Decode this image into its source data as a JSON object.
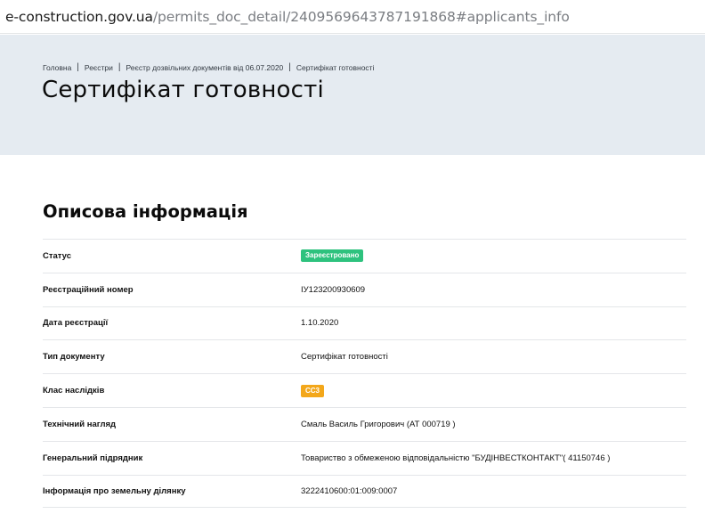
{
  "browser": {
    "url_host": "e-construction.gov.ua",
    "url_path": "/permits_doc_detail/2409569643787191868#applicants_info"
  },
  "breadcrumb": {
    "items": [
      "Головна",
      "Реєстри",
      "Реєстр дозвільних документів від 06.07.2020",
      "Сертифікат готовності"
    ],
    "separator": "|"
  },
  "page": {
    "title": "Сертифікат готовності"
  },
  "section": {
    "title": "Описова інформація"
  },
  "colors": {
    "status_badge": "#2ec27e",
    "class_badge": "#f3a71a",
    "hero_background": "#e5ebf1"
  },
  "rows": [
    {
      "label": "Статус",
      "value": "Зареєстровано"
    },
    {
      "label": "Реєстраційний номер",
      "value": "ІУ123200930609"
    },
    {
      "label": "Дата реєстрації",
      "value": "1.10.2020"
    },
    {
      "label": "Тип документу",
      "value": "Сертифікат готовності"
    },
    {
      "label": "Клас наслідків",
      "value": "СС3"
    },
    {
      "label": "Технічний нагляд",
      "value": "Смаль Василь Григорович (АТ 000719 )"
    },
    {
      "label": "Генеральний підрядник",
      "value": "Товариство з обмеженою відповідальністю \"БУДІНВЕСТКОНТАКТ\"( 41150746 )"
    },
    {
      "label": "Інформація про земельну ділянку",
      "value": "3222410600:01:009:0007"
    }
  ]
}
